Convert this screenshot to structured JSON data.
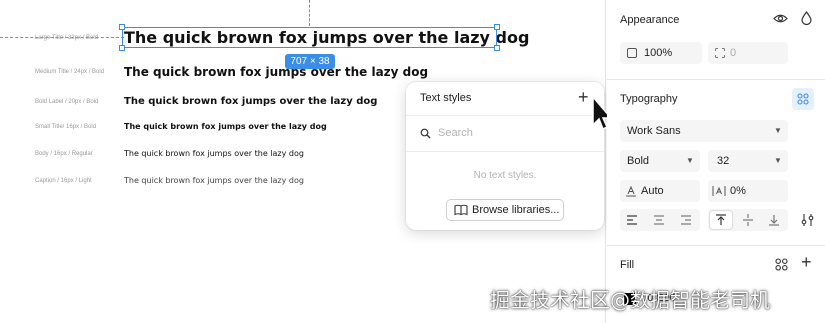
{
  "canvas": {
    "selection_dimensions": "707 × 38",
    "rows": [
      {
        "label": "Large Title / 32px / Bold",
        "sample": "The quick brown fox jumps over the lazy dog"
      },
      {
        "label": "Medium Title / 24px / Bold",
        "sample": "The quick brown fox jumps over the lazy dog"
      },
      {
        "label": "Bold Label / 20px / Bold",
        "sample": "The quick brown fox jumps over the lazy dog"
      },
      {
        "label": "Small Title/ 16px / Bold",
        "sample": "The quick brown fox jumps over the lazy dog"
      },
      {
        "label": "Body / 16px / Regular",
        "sample": "The quick brown fox jumps over the lazy dog"
      },
      {
        "label": "Caption / 16px / Light",
        "sample": "The quick brown fox jumps over the lazy dog"
      }
    ]
  },
  "popover": {
    "title": "Text styles",
    "search_placeholder": "Search",
    "empty_text": "No text styles.",
    "browse_label": "Browse libraries..."
  },
  "panel": {
    "appearance": {
      "title": "Appearance",
      "opacity": "100%",
      "corner_radius": "0"
    },
    "typography": {
      "title": "Typography",
      "font_family": "Work Sans",
      "font_weight": "Bold",
      "font_size": "32",
      "line_height": "Auto",
      "letter_spacing": "0%"
    },
    "fill": {
      "title": "Fill",
      "color": "000000"
    }
  },
  "watermark": "掘金技术社区@数据智能老司机",
  "colors": {
    "accent": "#3b8ee8",
    "field_bg": "#f5f5f5"
  }
}
